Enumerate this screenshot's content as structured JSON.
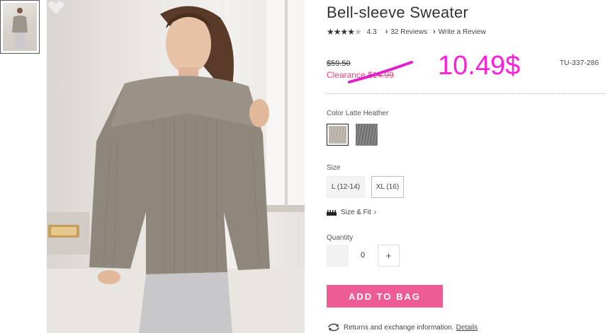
{
  "product": {
    "title": "Bell-sleeve Sweater",
    "rating_value": "4.3",
    "rating_stars": 4.3,
    "reviews_link": "32 Reviews",
    "write_review_link": "Write a Review",
    "old_price": "$59.50",
    "clearance_label": "Clearance",
    "clearance_price": "$14.99",
    "handwritten_price": "10.49$",
    "sku": "TU-337-286"
  },
  "color": {
    "label": "Color",
    "selected": "Latte Heather",
    "swatches": [
      "Latte Heather",
      "Heather Gray"
    ]
  },
  "size": {
    "label": "Size",
    "options": [
      "L (12-14)",
      "XL (16)"
    ],
    "size_fit_link": "Size & Fit"
  },
  "quantity": {
    "label": "Quantity",
    "value": "0",
    "plus": "+"
  },
  "actions": {
    "add_to_bag": "ADD TO BAG",
    "returns_text": "Returns and exchange information.",
    "details_link": "Details"
  },
  "icons": {
    "favorite": "heart-icon",
    "ruler": "ruler-icon",
    "returns": "refresh-icon",
    "chevron": "chevron-right-icon"
  },
  "colors": {
    "accent_pink": "#ee5c95",
    "clearance_pink": "#e0457b",
    "annotation_magenta": "#ff1fd8"
  }
}
